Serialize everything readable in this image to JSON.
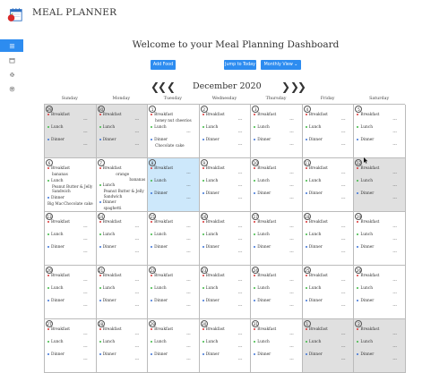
{
  "app": {
    "title": "MEAL PLANNER"
  },
  "sidebar": {
    "items": [
      {
        "icon": "menu-icon",
        "active": true
      },
      {
        "icon": "calendar-icon",
        "active": false
      },
      {
        "icon": "gear-icon",
        "active": false
      },
      {
        "icon": "heart-icon",
        "active": false
      }
    ]
  },
  "welcome": "Welcome to your Meal Planning Dashboard",
  "buttons": {
    "add_food": "Add Food",
    "jump_today": "Jump to Today",
    "view": "Monthly View ⌄"
  },
  "nav": {
    "prev": "❮❮ ❮",
    "next": "❯ ❯❯",
    "month": "December 2020"
  },
  "days_of_week": [
    "Sunday",
    "Monday",
    "Tuesday",
    "Wednesday",
    "Thursday",
    "Friday",
    "Saturday"
  ],
  "meals": {
    "breakfast": "Breakfast",
    "lunch": "Lunch",
    "dinner": "Dinner",
    "empty": "---"
  },
  "colors": {
    "accent": "#2d8cf0",
    "muted": "#e0e0e0",
    "today": "#cde8fb",
    "breakfast": "#d93434",
    "lunch": "#3db843",
    "dinner": "#3a72d6"
  },
  "weeks": [
    [
      {
        "day": "29",
        "state": "muted",
        "b": [],
        "l": [],
        "d": []
      },
      {
        "day": "30",
        "state": "muted",
        "b": [],
        "l": [],
        "d": []
      },
      {
        "day": "1",
        "state": "normal",
        "b": [
          "honey nut cheerios"
        ],
        "l": [],
        "d": [
          "Chocolate cake"
        ]
      },
      {
        "day": "2",
        "state": "normal",
        "b": [],
        "l": [],
        "d": []
      },
      {
        "day": "3",
        "state": "normal",
        "b": [],
        "l": [],
        "d": []
      },
      {
        "day": "4",
        "state": "normal",
        "b": [],
        "l": [],
        "d": []
      },
      {
        "day": "5",
        "state": "normal",
        "b": [],
        "l": [],
        "d": []
      }
    ],
    [
      {
        "day": "6",
        "state": "normal",
        "b": [
          "bananas"
        ],
        "l": [
          "Peanut Butter & Jelly",
          "Sandwich"
        ],
        "d": [
          "Big Mac",
          "Chocolate cake",
          "honey nut cheerios"
        ]
      },
      {
        "day": "7",
        "state": "normal",
        "b": [
          "orange",
          "bananas"
        ],
        "l": [
          "Peanut Butter & Jelly",
          "Sandwich"
        ],
        "d": [
          "spaghetti"
        ]
      },
      {
        "day": "8",
        "state": "today",
        "b": [],
        "l": [],
        "d": []
      },
      {
        "day": "9",
        "state": "normal",
        "b": [],
        "l": [],
        "d": []
      },
      {
        "day": "10",
        "state": "normal",
        "b": [],
        "l": [],
        "d": []
      },
      {
        "day": "11",
        "state": "normal",
        "b": [],
        "l": [],
        "d": []
      },
      {
        "day": "12",
        "state": "muted",
        "b": [],
        "l": [],
        "d": []
      }
    ],
    [
      {
        "day": "13",
        "state": "normal",
        "b": [],
        "l": [],
        "d": []
      },
      {
        "day": "14",
        "state": "normal",
        "b": [],
        "l": [],
        "d": []
      },
      {
        "day": "15",
        "state": "normal",
        "b": [],
        "l": [],
        "d": []
      },
      {
        "day": "16",
        "state": "normal",
        "b": [],
        "l": [],
        "d": []
      },
      {
        "day": "17",
        "state": "normal",
        "b": [],
        "l": [],
        "d": []
      },
      {
        "day": "18",
        "state": "normal",
        "b": [],
        "l": [],
        "d": []
      },
      {
        "day": "19",
        "state": "normal",
        "b": [],
        "l": [],
        "d": []
      }
    ],
    [
      {
        "day": "20",
        "state": "normal",
        "b": [],
        "l": [],
        "d": []
      },
      {
        "day": "21",
        "state": "normal",
        "b": [],
        "l": [],
        "d": []
      },
      {
        "day": "22",
        "state": "normal",
        "b": [],
        "l": [],
        "d": []
      },
      {
        "day": "23",
        "state": "normal",
        "b": [],
        "l": [],
        "d": []
      },
      {
        "day": "24",
        "state": "normal",
        "b": [],
        "l": [],
        "d": []
      },
      {
        "day": "25",
        "state": "normal",
        "b": [],
        "l": [],
        "d": []
      },
      {
        "day": "26",
        "state": "normal",
        "b": [],
        "l": [],
        "d": []
      }
    ],
    [
      {
        "day": "27",
        "state": "normal",
        "b": [],
        "l": [],
        "d": []
      },
      {
        "day": "28",
        "state": "normal",
        "b": [],
        "l": [],
        "d": []
      },
      {
        "day": "29",
        "state": "normal",
        "b": [],
        "l": [],
        "d": []
      },
      {
        "day": "30",
        "state": "normal",
        "b": [],
        "l": [],
        "d": []
      },
      {
        "day": "31",
        "state": "normal",
        "b": [],
        "l": [],
        "d": []
      },
      {
        "day": "1",
        "state": "muted",
        "b": [],
        "l": [],
        "d": []
      },
      {
        "day": "2",
        "state": "muted",
        "b": [],
        "l": [],
        "d": []
      }
    ]
  ]
}
